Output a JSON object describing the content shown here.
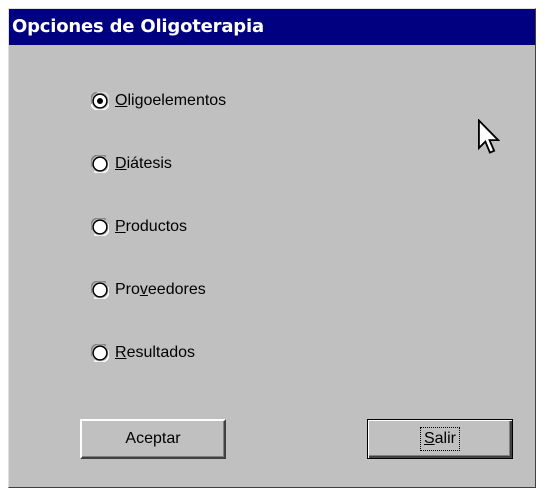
{
  "dialog": {
    "title": "Opciones de Oligoterapia"
  },
  "options": [
    {
      "pre": "",
      "key": "O",
      "post": "ligoelementos",
      "checked": true
    },
    {
      "pre": "",
      "key": "D",
      "post": "iátesis",
      "checked": false
    },
    {
      "pre": "",
      "key": "P",
      "post": "roductos",
      "checked": false
    },
    {
      "pre": "Pro",
      "key": "v",
      "post": "eedores",
      "checked": false
    },
    {
      "pre": "",
      "key": "R",
      "post": "esultados",
      "checked": false
    }
  ],
  "buttons": {
    "accept_label": "Aceptar",
    "exit_pre": "",
    "exit_key": "S",
    "exit_post": "alir"
  },
  "colors": {
    "titlebar": "#000080",
    "face": "#c0c0c0"
  },
  "icons": {
    "cursor": "arrow-cursor-icon"
  }
}
